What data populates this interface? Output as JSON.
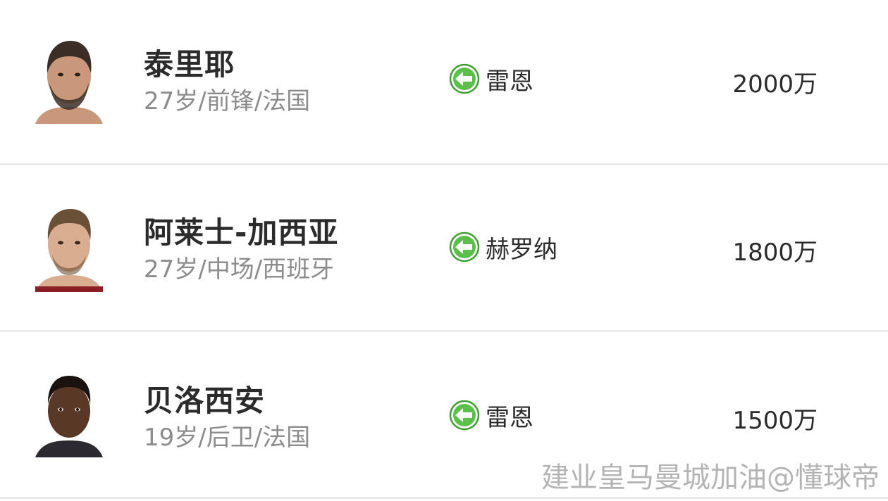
{
  "players": [
    {
      "name": "泰里耶",
      "meta": "27岁/前锋/法国",
      "from_club": "雷恩",
      "fee": "2000万",
      "skin": "#c9987a",
      "hair": "#3a2e26"
    },
    {
      "name": "阿莱士-加西亚",
      "meta": "27岁/中场/西班牙",
      "from_club": "赫罗纳",
      "fee": "1800万",
      "skin": "#d8ad90",
      "hair": "#6b5038"
    },
    {
      "name": "贝洛西安",
      "meta": "19岁/后卫/法国",
      "from_club": "雷恩",
      "fee": "1500万",
      "skin": "#5a3826",
      "hair": "#1a120e"
    }
  ],
  "icons": {
    "transfer_in": "green-arrow-left-icon",
    "avatar": "player-avatar"
  },
  "colors": {
    "arrow_green": "#5cbf4a",
    "arrow_ring": "#3f9e34"
  },
  "watermark": "建业皇马曼城加油@懂球帝"
}
